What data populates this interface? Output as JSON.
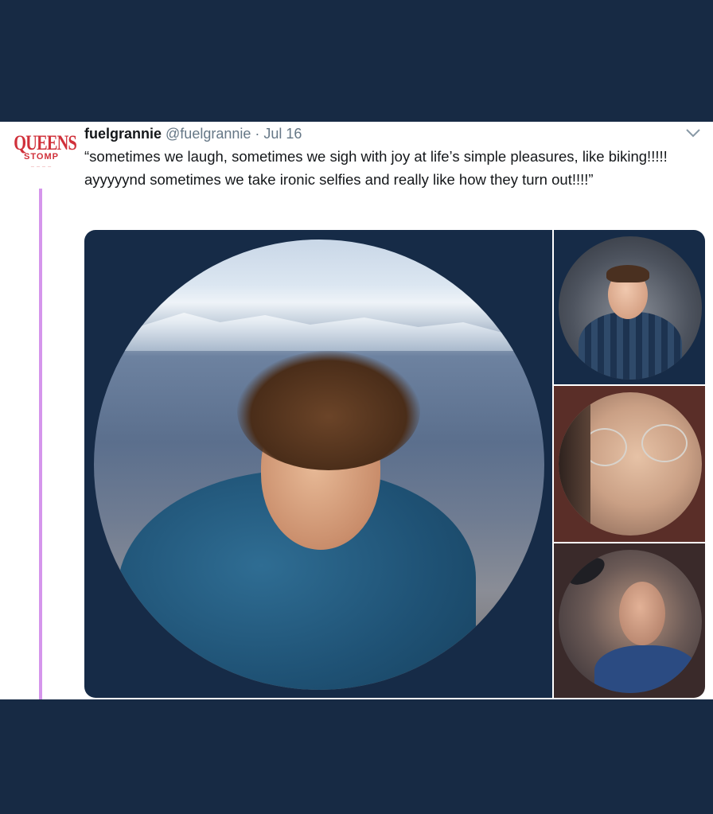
{
  "tweet": {
    "author_name": "fuelgrannie",
    "handle": "@fuelgrannie",
    "separator": "·",
    "date": "Jul 16",
    "text": "“sometimes we laugh, sometimes we sigh with joy at life’s simple pleasures, like biking!!!!! ayyyyynd sometimes we take ironic selfies and really like how they turn out!!!!”",
    "avatar": {
      "logo_line1": "QUEENS",
      "logo_line2": "STOMP",
      "icon": "queens-stomp-logo"
    },
    "menu_icon": "chevron-down-icon",
    "thread_line_color": "#d595ec"
  },
  "media": {
    "count": 4,
    "items": [
      {
        "icon": "photo-mountain-portrait"
      },
      {
        "icon": "photo-plaid-shirt-selfie"
      },
      {
        "icon": "photo-glasses-closeup"
      },
      {
        "icon": "photo-bearded-man-selfie"
      }
    ]
  },
  "colors": {
    "page_background": "#172a44",
    "name": "#14171a",
    "muted": "#657786"
  }
}
